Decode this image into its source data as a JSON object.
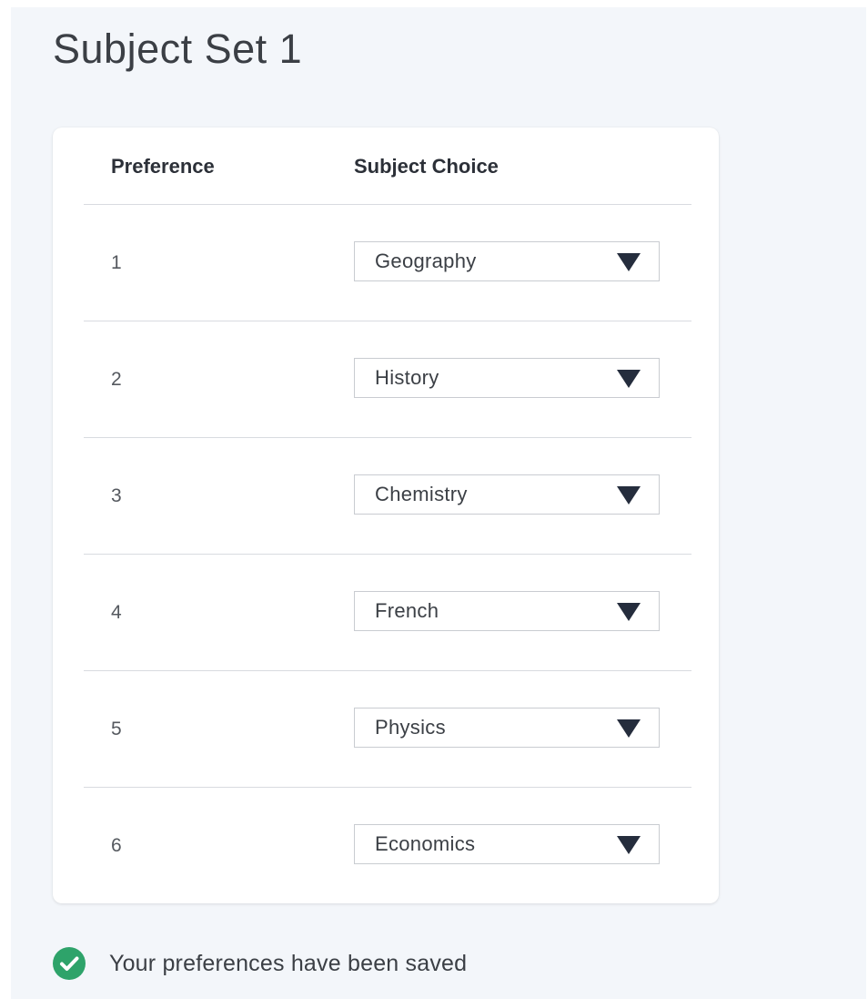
{
  "page": {
    "title": "Subject Set 1"
  },
  "table": {
    "headers": {
      "preference": "Preference",
      "subject_choice": "Subject Choice"
    },
    "rows": [
      {
        "preference": "1",
        "subject": "Geography"
      },
      {
        "preference": "2",
        "subject": "History"
      },
      {
        "preference": "3",
        "subject": "Chemistry"
      },
      {
        "preference": "4",
        "subject": "French"
      },
      {
        "preference": "5",
        "subject": "Physics"
      },
      {
        "preference": "6",
        "subject": "Economics"
      }
    ]
  },
  "status": {
    "message": "Your preferences have been saved",
    "icon": "check-circle-icon",
    "color": "#2ea36a"
  },
  "colors": {
    "background": "#f3f6fa",
    "card": "#ffffff",
    "caret": "#252d3d"
  }
}
